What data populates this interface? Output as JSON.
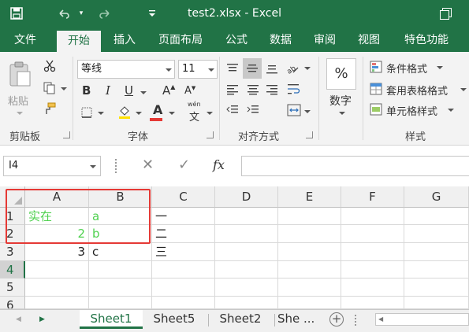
{
  "title": "test2.xlsx  -  Excel",
  "quick_access": {
    "save": "save-icon",
    "undo": "undo-icon",
    "redo": "redo-icon",
    "customize": "customize-icon"
  },
  "tabs": [
    "文件",
    "开始",
    "插入",
    "页面布局",
    "公式",
    "数据",
    "审阅",
    "视图",
    "特色功能"
  ],
  "active_tab": "开始",
  "ribbon": {
    "clipboard": {
      "paste": "粘贴",
      "group": "剪贴板"
    },
    "font": {
      "name": "等线",
      "size": "11",
      "bold": "B",
      "italic": "I",
      "underline": "U",
      "grow": "A",
      "shrink": "A",
      "font_color_letter": "A",
      "phonetic": "wén",
      "phonetic_char": "文",
      "group": "字体",
      "font_color": "#e53935"
    },
    "alignment": {
      "group": "对齐方式"
    },
    "number": {
      "percent": "%",
      "label": "数字"
    },
    "styles": {
      "conditional": "条件格式",
      "table": "套用表格格式",
      "cell": "单元格样式",
      "group": "样式"
    }
  },
  "formula_bar": {
    "name_box": "I4",
    "cancel": "✕",
    "enter": "✓",
    "fx": "fx",
    "formula": ""
  },
  "columns": [
    "A",
    "B",
    "C",
    "D",
    "E",
    "F",
    "G"
  ],
  "rows": [
    {
      "num": "1",
      "A": "实在",
      "B": "a",
      "C": "一"
    },
    {
      "num": "2",
      "A": "2",
      "B": "b",
      "C": "二"
    },
    {
      "num": "3",
      "A": "3",
      "B": "c",
      "C": "三"
    },
    {
      "num": "4",
      "A": "",
      "B": "",
      "C": ""
    },
    {
      "num": "5",
      "A": "",
      "B": "",
      "C": ""
    },
    {
      "num": "6",
      "A": "",
      "B": "",
      "C": ""
    }
  ],
  "active_row": "4",
  "sheets": [
    "Sheet1",
    "Sheet5",
    "Sheet2",
    "She ..."
  ],
  "active_sheet": "Sheet1",
  "colors": {
    "excel_green": "#217346",
    "annotation_red": "#e53935",
    "green_text": "#4fd14f"
  }
}
